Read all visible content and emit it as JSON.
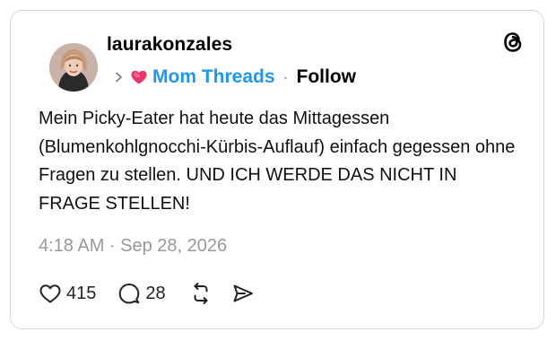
{
  "post": {
    "username": "laurakonzales",
    "community": "Mom Threads",
    "separator": "·",
    "follow_label": "Follow",
    "text": "Mein Picky-Eater hat heute das Mittagessen (Blumenkohlgnocchi-Kürbis-Auflauf) einfach gegessen ohne Fragen zu stellen. UND ICH WERDE DAS NICHT IN FRAGE STELLEN!",
    "timestamp": "4:18 AM · Sep 28, 2026",
    "likes": "415",
    "replies": "28"
  },
  "icons": {
    "logo": "threads-logo-icon",
    "chevron": "chevron-right-icon",
    "community": "pink-heart-icon",
    "like": "heart-outline-icon",
    "reply": "speech-bubble-icon",
    "repost": "repost-arrows-icon",
    "share": "send-arrow-icon"
  },
  "colors": {
    "community_accent": "#1f98e9",
    "community_icon": "#e8336b",
    "timestamp": "#999999",
    "border": "#d6d6d6"
  }
}
